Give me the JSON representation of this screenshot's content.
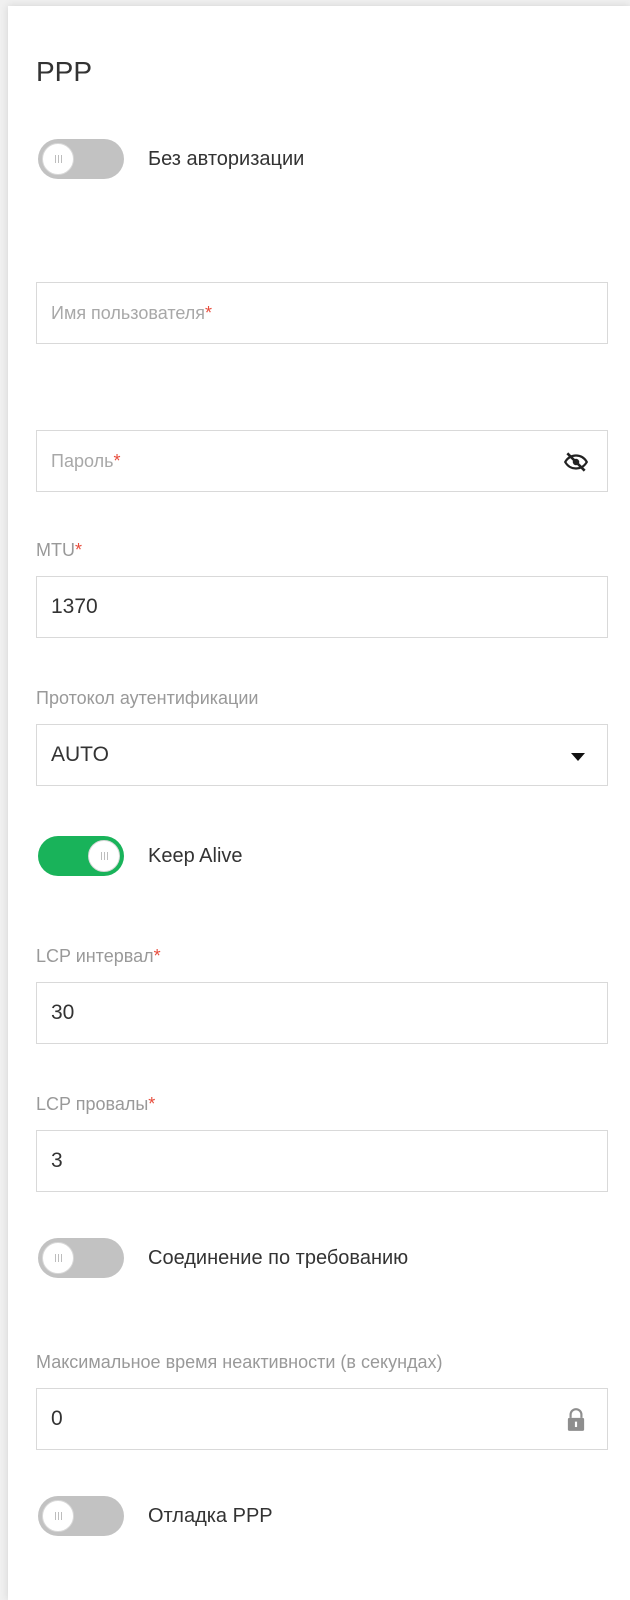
{
  "section_title": "PPP",
  "toggles": {
    "no_auth": {
      "label": "Без авторизации",
      "state": "off"
    },
    "keep_alive": {
      "label": "Keep Alive",
      "state": "on"
    },
    "on_demand": {
      "label": "Соединение по требованию",
      "state": "off"
    },
    "debug": {
      "label": "Отладка PPP",
      "state": "off"
    }
  },
  "fields": {
    "username": {
      "placeholder": "Имя пользователя",
      "required_mark": "*"
    },
    "password": {
      "placeholder": "Пароль",
      "required_mark": "*",
      "icon": "eye-off-icon"
    },
    "mtu": {
      "label": "MTU",
      "required_mark": "*",
      "value": "1370"
    },
    "auth_protocol": {
      "label": "Протокол аутентификации",
      "value": "AUTO",
      "icon": "caret-down-icon"
    },
    "lcp_interval": {
      "label": "LCP интервал",
      "required_mark": "*",
      "value": "30"
    },
    "lcp_failures": {
      "label": "LCP провалы",
      "required_mark": "*",
      "value": "3"
    },
    "idle_timeout": {
      "label": "Максимальное время неактивности (в секундах)",
      "value": "0",
      "icon": "lock-icon"
    }
  },
  "colors": {
    "toggle_on": "#19b35a",
    "toggle_off": "#c2c2c2",
    "required": "#e74c3c"
  }
}
